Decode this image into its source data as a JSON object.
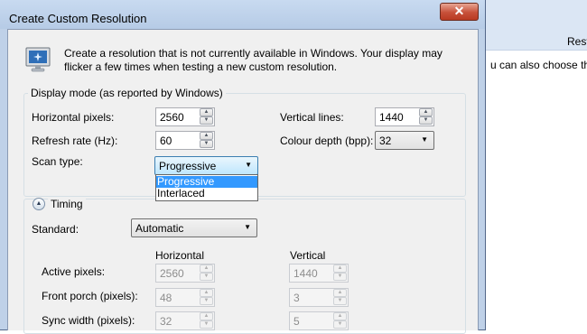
{
  "background": {
    "header_text": "Rest",
    "body_text": "u can also choose the"
  },
  "window": {
    "title": "Create Custom Resolution",
    "close_icon": "close-x-icon",
    "close_glyph": "✕"
  },
  "intro": {
    "icon": "monitor-icon",
    "text": "Create a resolution that is not currently available in Windows. Your display may flicker a few times when testing a new custom resolution."
  },
  "display_mode": {
    "caption": "Display mode (as reported by Windows)",
    "horizontal_pixels": {
      "label": "Horizontal pixels:",
      "value": "2560"
    },
    "vertical_lines": {
      "label": "Vertical lines:",
      "value": "1440"
    },
    "refresh_rate": {
      "label": "Refresh rate (Hz):",
      "value": "60"
    },
    "colour_depth": {
      "label": "Colour depth (bpp):",
      "value": "32"
    },
    "scan_type": {
      "label": "Scan type:",
      "value": "Progressive",
      "options": [
        "Progressive",
        "Interlaced"
      ],
      "highlighted": "Progressive"
    }
  },
  "timing": {
    "caption": "Timing",
    "toggle_icon": "collapse-up-icon",
    "toggle_glyph": "▲",
    "standard": {
      "label": "Standard:",
      "value": "Automatic"
    },
    "horizontal_header": "Horizontal",
    "vertical_header": "Vertical",
    "rows": [
      {
        "label": "Active pixels:",
        "horizontal": "2560",
        "vertical": "1440"
      },
      {
        "label": "Front porch (pixels):",
        "horizontal": "48",
        "vertical": "3"
      },
      {
        "label": "Sync width (pixels):",
        "horizontal": "32",
        "vertical": "5"
      }
    ]
  },
  "spin_glyphs": {
    "up": "▲",
    "down": "▼"
  },
  "combo_glyph": "▼"
}
